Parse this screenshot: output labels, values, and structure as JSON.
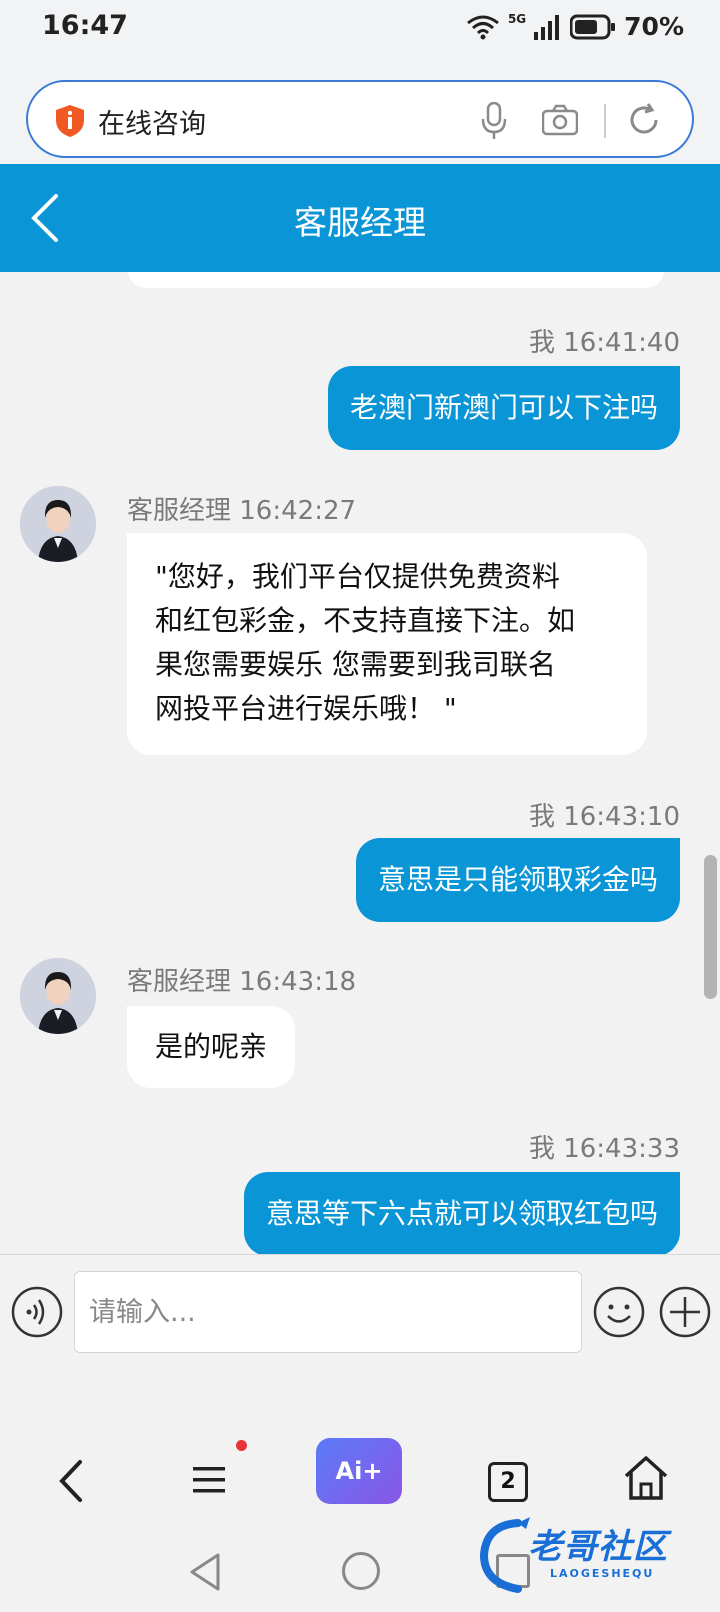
{
  "status_bar": {
    "time": "16:47",
    "network": "5G",
    "battery": "70%"
  },
  "address_bar": {
    "text": "在线咨询"
  },
  "header": {
    "title": "客服经理"
  },
  "messages": [
    {
      "direction": "out",
      "meta": "我 16:41:40",
      "text": "老澳门新澳门可以下注吗"
    },
    {
      "direction": "in",
      "meta": "客服经理 16:42:27",
      "lines": [
        "\"您好，我们平台仅提供免费资料",
        "和红包彩金，不支持直接下注。如",
        "果您需要娱乐 您需要到我司联名",
        "网投平台进行娱乐哦！ \""
      ]
    },
    {
      "direction": "out",
      "meta": "我 16:43:10",
      "text": "意思是只能领取彩金吗"
    },
    {
      "direction": "in",
      "meta": "客服经理 16:43:18",
      "text": "是的呢亲"
    },
    {
      "direction": "out",
      "meta": "我 16:43:33",
      "text": "意思等下六点就可以领取红包吗"
    }
  ],
  "input": {
    "placeholder": "请输入..."
  },
  "bottom_nav": {
    "ai_label": "Ai+",
    "tab_count": "2"
  },
  "watermark": {
    "text": "老哥社区",
    "sub": "LAOGESHEQU"
  },
  "colors": {
    "accent": "#0a96d6",
    "background": "#f2f2f2"
  }
}
